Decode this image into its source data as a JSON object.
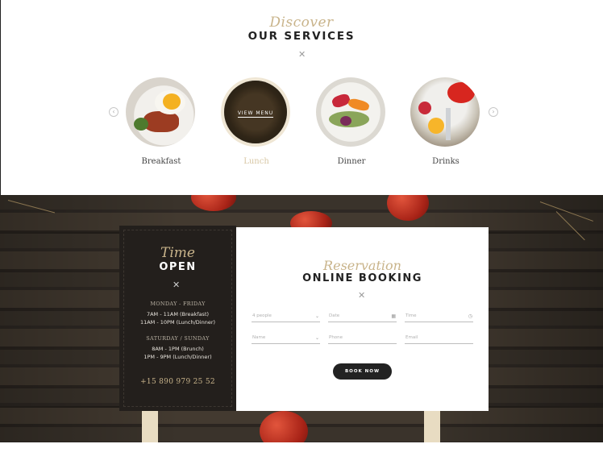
{
  "services": {
    "script": "Discover",
    "title": "OUR SERVICES",
    "cutlery_icon": "fork-knife-icon",
    "prev_icon": "chevron-left-icon",
    "next_icon": "chevron-right-icon",
    "items": [
      {
        "label": "Breakfast",
        "active": false
      },
      {
        "label": "Lunch",
        "active": true,
        "overlay": "VIEW MENU"
      },
      {
        "label": "Dinner",
        "active": false
      },
      {
        "label": "Drinks",
        "active": false
      }
    ]
  },
  "hours": {
    "script": "Time",
    "title": "OPEN",
    "weekday_heading": "MONDAY - FRIDAY",
    "weekday_lines": [
      "7AM - 11AM (Breakfast)",
      "11AM - 10PM (Lunch/Dinner)"
    ],
    "weekend_heading": "SATURDAY / SUNDAY",
    "weekend_lines": [
      "8AM - 1PM (Brunch)",
      "1PM - 9PM (Lunch/Dinner)"
    ],
    "phone": "+15 890 979 25 52"
  },
  "booking": {
    "script": "Reservation",
    "title": "ONLINE BOOKING",
    "fields": {
      "people": "4 people",
      "date": "Date",
      "time": "Time",
      "name": "Name",
      "phone": "Phone",
      "email": "Email"
    },
    "button": "BOOK NOW"
  },
  "colors": {
    "accent": "#c9b48b",
    "dark": "#231f1c",
    "text": "#222222"
  }
}
